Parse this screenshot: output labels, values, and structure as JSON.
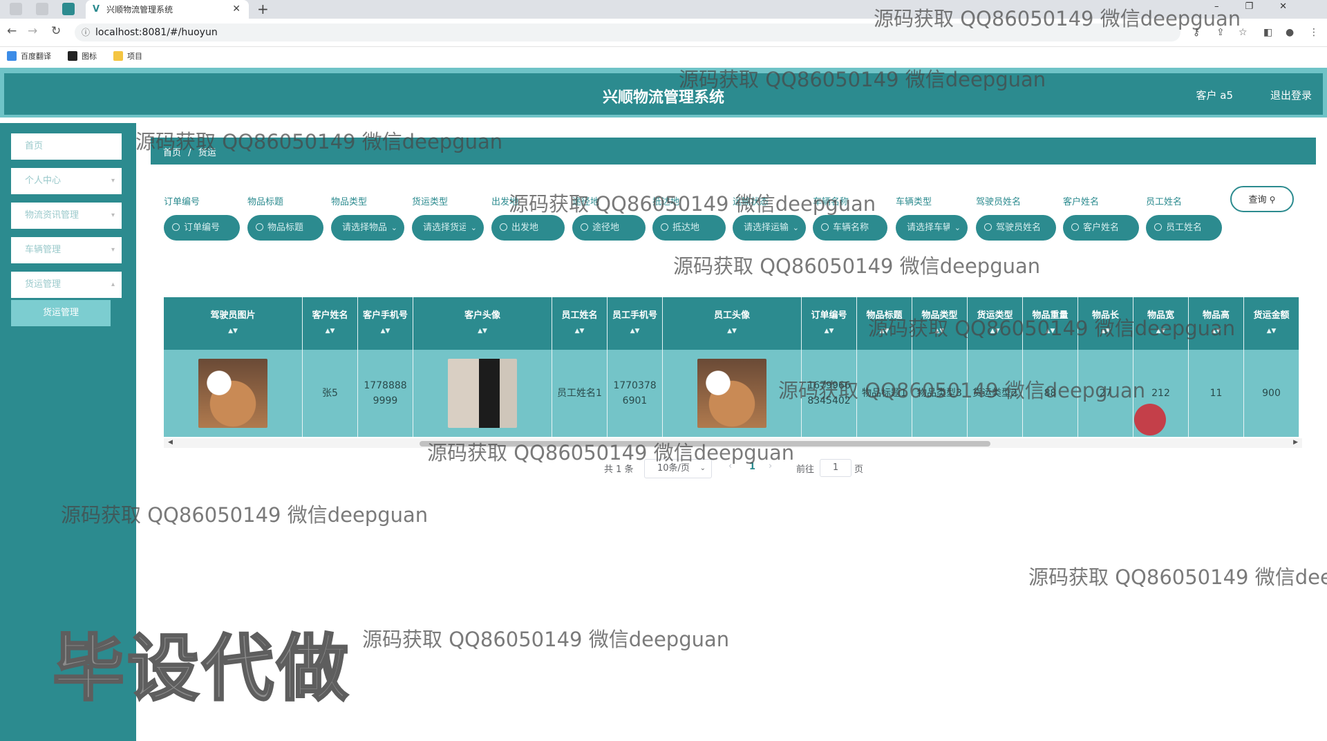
{
  "browser": {
    "tab_title": "兴顺物流管理系统",
    "url": "localhost:8081/#/huoyun",
    "bookmarks": [
      "百度翻译",
      "图标",
      "项目"
    ]
  },
  "header": {
    "title": "兴顺物流管理系统",
    "user": "客户 a5",
    "logout": "退出登录"
  },
  "sidebar": {
    "items": [
      {
        "label": "首页",
        "expandable": false
      },
      {
        "label": "个人中心",
        "expandable": true
      },
      {
        "label": "物流资讯管理",
        "expandable": true
      },
      {
        "label": "车辆管理",
        "expandable": true
      },
      {
        "label": "货运管理",
        "expandable": true
      }
    ],
    "active_sub": "货运管理"
  },
  "breadcrumb": {
    "home": "首页",
    "sep": "/",
    "current": "货运"
  },
  "search": {
    "labels": [
      "订单编号",
      "物品标题",
      "物品类型",
      "货运类型",
      "出发地",
      "途径地",
      "抵达地",
      "运输状态",
      "车辆名称",
      "车辆类型",
      "驾驶员姓名",
      "客户姓名",
      "员工姓名"
    ],
    "fields": [
      {
        "text": "订单编号",
        "kind": "search"
      },
      {
        "text": "物品标题",
        "kind": "search"
      },
      {
        "text": "请选择物品类型",
        "kind": "select"
      },
      {
        "text": "请选择货运类型",
        "kind": "select"
      },
      {
        "text": "出发地",
        "kind": "search"
      },
      {
        "text": "途径地",
        "kind": "search"
      },
      {
        "text": "抵达地",
        "kind": "search"
      },
      {
        "text": "请选择运输状态",
        "kind": "select"
      },
      {
        "text": "车辆名称",
        "kind": "search"
      },
      {
        "text": "请选择车辆类型",
        "kind": "select"
      },
      {
        "text": "驾驶员姓名",
        "kind": "search"
      },
      {
        "text": "客户姓名",
        "kind": "search"
      },
      {
        "text": "员工姓名",
        "kind": "search"
      }
    ],
    "query_button": "查询"
  },
  "table": {
    "columns": [
      {
        "title": "驾驶员图片",
        "type": "image"
      },
      {
        "title": "客户姓名"
      },
      {
        "title": "客户手机号"
      },
      {
        "title": "客户头像",
        "type": "image"
      },
      {
        "title": "员工姓名"
      },
      {
        "title": "员工手机号"
      },
      {
        "title": "员工头像",
        "type": "image"
      },
      {
        "title": "订单编号"
      },
      {
        "title": "物品标题"
      },
      {
        "title": "物品类型"
      },
      {
        "title": "货运类型"
      },
      {
        "title": "物品重量"
      },
      {
        "title": "物品长"
      },
      {
        "title": "物品宽"
      },
      {
        "title": "物品高"
      },
      {
        "title": "货运金额"
      }
    ],
    "rows": [
      {
        "cells": [
          {
            "image": "cat-photo"
          },
          {
            "text": "张5"
          },
          {
            "text": "17788889999"
          },
          {
            "image": "person-photo"
          },
          {
            "text": "员工姓名1"
          },
          {
            "text": "17703786901"
          },
          {
            "image": "cat-photo"
          },
          {
            "text": "16799668345402"
          },
          {
            "text": "物品标题1"
          },
          {
            "text": "物品类型3"
          },
          {
            "text": "货运类型2"
          },
          {
            "text": "88"
          },
          {
            "text": "27"
          },
          {
            "text": "212"
          },
          {
            "text": "11"
          },
          {
            "text": "900"
          }
        ]
      }
    ]
  },
  "pagination": {
    "total": "共 1 条",
    "page_size": "10条/页",
    "current_page": "1",
    "goto_label": "前往",
    "goto_value": "1",
    "page_unit": "页"
  },
  "watermark": {
    "text": "源码获取 QQ86050149 微信deepguan",
    "big_text": "毕设代做"
  },
  "colors": {
    "primary": "#2c8b8f",
    "row_bg": "#74c4c8",
    "header_light": "#6fc3c7"
  }
}
